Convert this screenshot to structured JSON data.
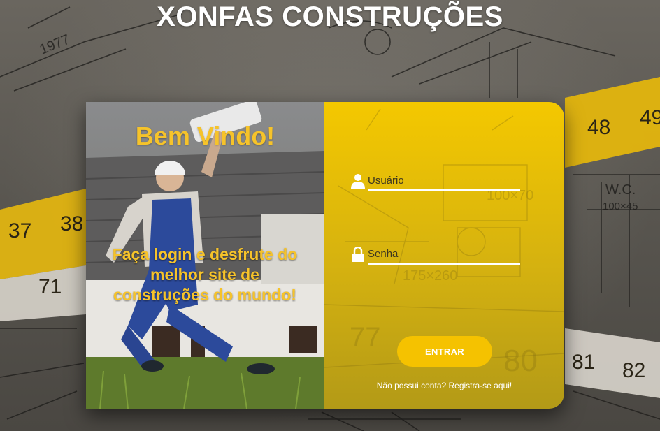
{
  "site": {
    "title": "XONFAS CONSTRUÇÕES"
  },
  "welcome": {
    "heading": "Bem Vindo!",
    "tagline": "Faça login e desfrute do melhor site de construções do mundo!"
  },
  "login": {
    "username_placeholder": "Usuário",
    "password_placeholder": "Senha",
    "submit_label": "ENTRAR",
    "register_text": "Não possui conta? Registra-se aqui!"
  },
  "icons": {
    "username": "user-icon",
    "password": "lock-icon"
  },
  "colors": {
    "accent_yellow": "#f6c32a",
    "panel_yellow": "#f4c800",
    "button_yellow": "#f5c200",
    "title_white": "#ffffff"
  }
}
